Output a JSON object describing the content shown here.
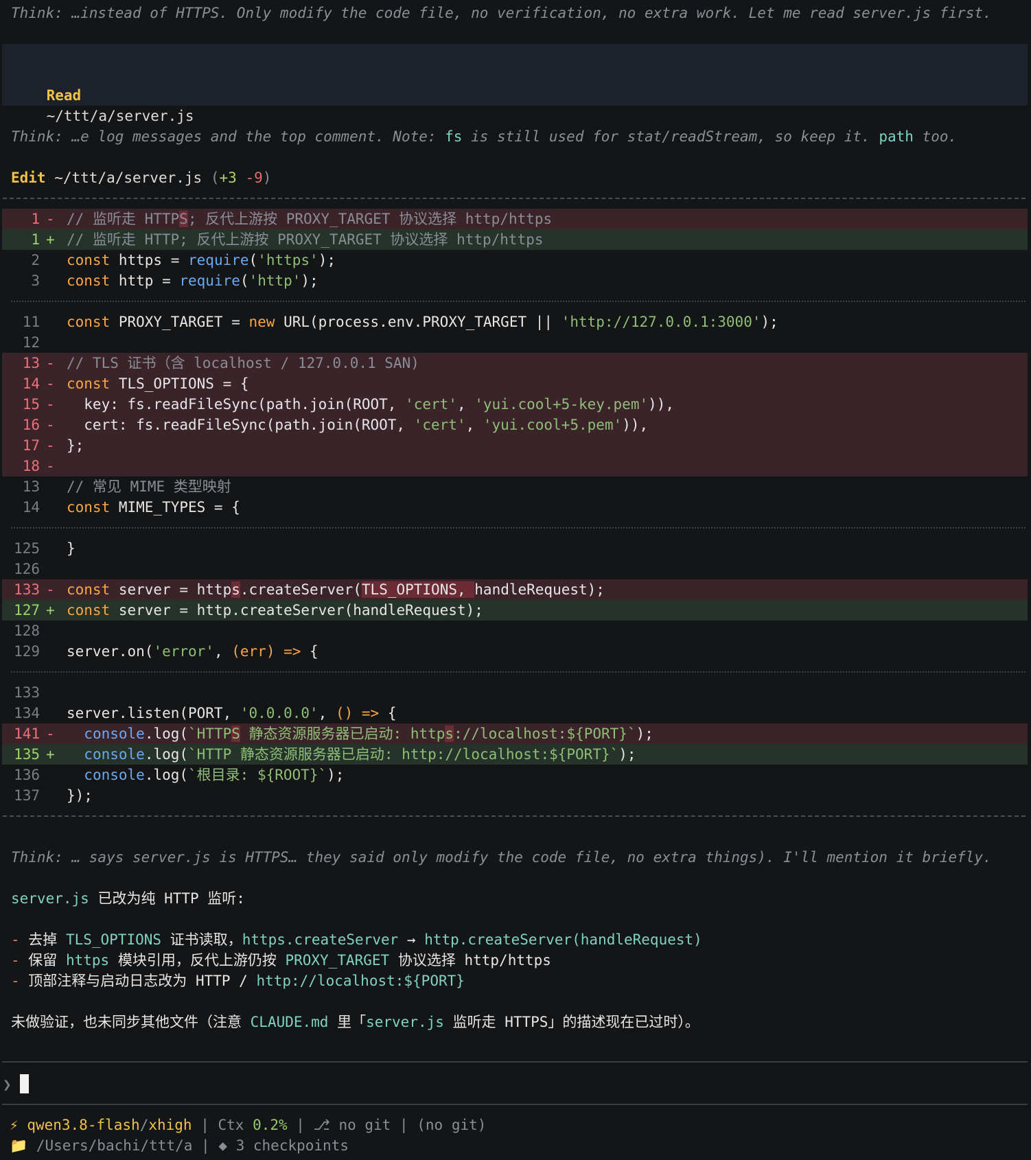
{
  "think1": "Think: …instead of HTTPS. Only modify the code file, no verification, no extra work. Let me read server.js first.",
  "read_tool": {
    "verb": "Read",
    "path": "~/ttt/a/server.js"
  },
  "think2": {
    "part1": "Think: …e log messages and the top comment. Note: ",
    "fs": "fs",
    "part2": " is still used for stat/readStream, so keep it. ",
    "path": "path",
    "part3": " too."
  },
  "edit_tool": {
    "verb": "Edit",
    "path": "~/ttt/a/server.js",
    "open": "(",
    "added": "+3",
    "removed": "-9",
    "close": ")"
  },
  "diff": {
    "h1": {
      "l1_del": {
        "n": "1",
        "m": "-",
        "a": "// 监听走 HTTP",
        "b": "S",
        "c": "; 反代上游按 PROXY_TARGET 协议选择 http/https"
      },
      "l1_add": {
        "n": "1",
        "m": "+",
        "text": "// 监听走 HTTP; 反代上游按 PROXY_TARGET 协议选择 http/https"
      },
      "l2": {
        "n": "2",
        "kw": "const",
        "v": " https = ",
        "fn": "require",
        "o": "(",
        "str": "'https'",
        "e": ");"
      },
      "l3": {
        "n": "3",
        "kw": "const",
        "v": " http = ",
        "fn": "require",
        "o": "(",
        "str": "'http'",
        "e": ");"
      }
    },
    "h2": {
      "l11": {
        "n": "11",
        "kw": "const",
        "v": " PROXY_TARGET = ",
        "kw2": "new",
        "v2": " URL(process.env.PROXY_TARGET || ",
        "str": "'http://127.0.0.1:3000'",
        "e": ");"
      },
      "l12": {
        "n": "12"
      },
      "d13": {
        "n": "13",
        "m": "-",
        "text": "// TLS 证书（含 localhost / 127.0.0.1 SAN)"
      },
      "d14": {
        "n": "14",
        "m": "-",
        "kw": "const",
        "v": " TLS_OPTIONS = {"
      },
      "d15": {
        "n": "15",
        "m": "-",
        "a": "  key: fs.readFileSync(path.join(ROOT, ",
        "s1": "'cert'",
        "b": ", ",
        "s2": "'yui.cool+5-key.pem'",
        "e": ")),"
      },
      "d16": {
        "n": "16",
        "m": "-",
        "a": "  cert: fs.readFileSync(path.join(ROOT, ",
        "s1": "'cert'",
        "b": ", ",
        "s2": "'yui.cool+5.pem'",
        "e": ")),"
      },
      "d17": {
        "n": "17",
        "m": "-",
        "text": "};"
      },
      "d18": {
        "n": "18",
        "m": "-"
      },
      "l13": {
        "n": "13",
        "text": "// 常见 MIME 类型映射"
      },
      "l14": {
        "n": "14",
        "kw": "const",
        "v": " MIME_TYPES = {"
      }
    },
    "h3": {
      "l125": {
        "n": "125",
        "text": "}"
      },
      "l126": {
        "n": "126"
      },
      "d133": {
        "n": "133",
        "m": "-",
        "kw": "const",
        "a": " server = http",
        "b": "s",
        "c": ".createServer(",
        "d": "TLS_OPTIONS, ",
        "e": "handleRequest);"
      },
      "a127": {
        "n": "127",
        "m": "+",
        "kw": "const",
        "v": " server = http.createServer(handleRequest);"
      },
      "l128": {
        "n": "128"
      },
      "l129": {
        "n": "129",
        "a": "server.on(",
        "str": "'error'",
        "b": ", ",
        "arg": "(err)",
        "arrow": " =>",
        "e": " {"
      }
    },
    "h4": {
      "l133": {
        "n": "133"
      },
      "l134": {
        "n": "134",
        "a": "server.listen(PORT, ",
        "str": "'0.0.0.0'",
        "b": ", ",
        "arg": "()",
        "arrow": " =>",
        "e": " {"
      },
      "d141": {
        "n": "141",
        "m": "-",
        "fn": "console",
        "a": ".log(",
        "s1": "`HTTP",
        "s2": "S",
        "s3": " 静态资源服务器已启动: http",
        "s4": "s",
        "s5": "://localhost:${PORT}`",
        "e": ");"
      },
      "a135": {
        "n": "135",
        "m": "+",
        "fn": "console",
        "a": ".log(",
        "str": "`HTTP 静态资源服务器已启动: http://localhost:${PORT}`",
        "e": ");"
      },
      "l136": {
        "n": "136",
        "fn": "console",
        "a": ".log(",
        "str": "`根目录: ${ROOT}`",
        "e": ");"
      },
      "l137": {
        "n": "137",
        "text": "});"
      }
    }
  },
  "think3": "Think: … says server.js is HTTPS… they said only modify the code file, no extra things). I'll mention it briefly.",
  "summary": {
    "title_code": "server.js",
    "title_rest": " 已改为纯 HTTP 监听:",
    "b1": {
      "dash": "-",
      "t1": " 去掉 ",
      "c1": "TLS_OPTIONS",
      "t2": " 证书读取，",
      "c2": "https.createServer",
      "t3": " → ",
      "c3": "http.createServer(handleRequest)"
    },
    "b2": {
      "dash": "-",
      "t1": " 保留 ",
      "c1": "https",
      "t2": " 模块引用，反代上游仍按 ",
      "c2": "PROXY_TARGET",
      "t3": " 协议选择 http/https"
    },
    "b3": {
      "dash": "-",
      "t1": " 顶部注释与启动日志改为 HTTP / ",
      "c1": "http://localhost:${PORT}"
    },
    "note": {
      "t1": "未做验证，也未同步其他文件（注意 ",
      "c1": "CLAUDE.md",
      "t2": " 里「",
      "c2": "server.js",
      "t3": " 监听走 HTTPS」的描述现在已过时）。"
    }
  },
  "prompt": {
    "arrow": "❯"
  },
  "status": {
    "bolt": "⚡",
    "model": "qwen3.8-flash",
    "slash": "/",
    "effort": "xhigh",
    "pipe": " | ",
    "ctx_label": "Ctx ",
    "ctx_value": "0.2%",
    "git_icon": "⎇",
    "git": " no git",
    "git2": "(no git)",
    "folder_icon": "📁",
    "cwd": " /Users/bachi/ttt/a",
    "cp_icon": "◆",
    "checkpoints": " 3 checkpoints"
  },
  "colors": {
    "background": "#141517",
    "deleted_bg": "#3b2429",
    "added_bg": "#25332a",
    "tool_box": "#1c212c",
    "accent_yellow": "#f0c245",
    "keyword": "#f7a64a",
    "string": "#8fbf76",
    "function": "#6aa9f2"
  }
}
